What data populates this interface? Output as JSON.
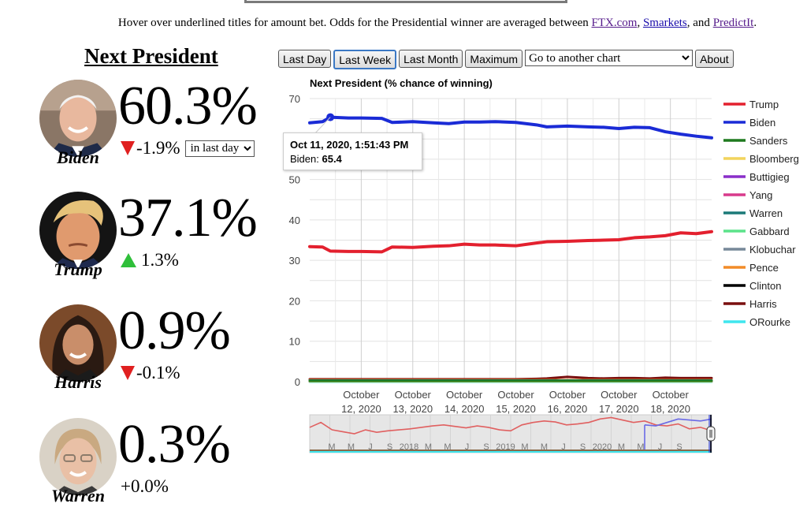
{
  "notice": {
    "text": "Hover over underlined titles for amount bet. Odds for the Presidential winner are averaged between ",
    "links": [
      "FTX.com",
      "Smarkets",
      "PredictIt"
    ],
    "sep1": ", ",
    "sep2": ", and ",
    "end": "."
  },
  "heading": "Next President",
  "candidates": [
    {
      "name": "Biden",
      "pct": "60.3%",
      "change": "-1.9%",
      "direction": "down"
    },
    {
      "name": "Trump",
      "pct": "37.1%",
      "change": "1.3%",
      "direction": "up"
    },
    {
      "name": "Harris",
      "pct": "0.9%",
      "change": "-0.1%",
      "direction": "down"
    },
    {
      "name": "Warren",
      "pct": "0.3%",
      "change": "+0.0%",
      "direction": "none"
    }
  ],
  "period_select": {
    "value": "in last day"
  },
  "toolbar": {
    "buttons": [
      "Last Day",
      "Last Week",
      "Last Month",
      "Maximum"
    ],
    "active": "Last Week",
    "chart_select": "Go to another chart",
    "about": "About"
  },
  "tooltip": {
    "title": "Oct 11, 2020, 1:51:43 PM",
    "label": "Biden: ",
    "value": "65.4"
  },
  "chart_data": {
    "type": "line",
    "title": "Next President (% chance of winning)",
    "xlabel": "",
    "ylabel": "",
    "ylim": [
      0,
      70
    ],
    "yticks": [
      0,
      10,
      20,
      30,
      40,
      50,
      60,
      70
    ],
    "ytick_labels": [
      "0",
      "10",
      "20",
      "",
      "30",
      "40",
      "50",
      "70"
    ],
    "grid": true,
    "legend": "right",
    "x_range_days": [
      0,
      7.8
    ],
    "xticks": [
      {
        "day": 1,
        "label": [
          "October",
          "12, 2020"
        ]
      },
      {
        "day": 2,
        "label": [
          "October",
          "13, 2020"
        ]
      },
      {
        "day": 3,
        "label": [
          "October",
          "14, 2020"
        ]
      },
      {
        "day": 4,
        "label": [
          "October",
          "15, 2020"
        ]
      },
      {
        "day": 5,
        "label": [
          "October",
          "16, 2020"
        ]
      },
      {
        "day": 6,
        "label": [
          "October",
          "17, 2020"
        ]
      },
      {
        "day": 7,
        "label": [
          "October",
          "18, 2020"
        ]
      }
    ],
    "x": [
      0,
      0.25,
      0.4,
      0.75,
      1.0,
      1.4,
      1.6,
      2.0,
      2.4,
      2.7,
      3.0,
      3.3,
      3.6,
      4.0,
      4.4,
      4.6,
      5.0,
      5.4,
      5.7,
      6.0,
      6.3,
      6.6,
      6.9,
      7.2,
      7.5,
      7.8
    ],
    "series": [
      {
        "name": "Trump",
        "color": "#e3202e",
        "values": [
          33.4,
          33.3,
          32.3,
          32.2,
          32.2,
          32.1,
          33.3,
          33.2,
          33.5,
          33.6,
          34.0,
          33.8,
          33.8,
          33.6,
          34.3,
          34.6,
          34.7,
          34.9,
          35.0,
          35.1,
          35.6,
          35.8,
          36.1,
          36.8,
          36.6,
          37.1
        ]
      },
      {
        "name": "Biden",
        "color": "#1a2bd6",
        "values": [
          64.0,
          64.3,
          65.4,
          65.2,
          65.2,
          65.1,
          64.1,
          64.3,
          64.0,
          63.8,
          64.2,
          64.2,
          64.3,
          64.1,
          63.5,
          63.0,
          63.2,
          63.0,
          62.9,
          62.6,
          62.9,
          62.8,
          61.8,
          61.2,
          60.7,
          60.3
        ]
      },
      {
        "name": "Sanders",
        "color": "#1f7a1f",
        "values": [
          0.2,
          0.2,
          0.2,
          0.2,
          0.2,
          0.2,
          0.2,
          0.2,
          0.2,
          0.2,
          0.2,
          0.2,
          0.2,
          0.2,
          0.2,
          0.2,
          0.2,
          0.2,
          0.2,
          0.2,
          0.2,
          0.2,
          0.2,
          0.2,
          0.2,
          0.2
        ]
      },
      {
        "name": "Bloomberg",
        "color": "#f2d45c",
        "values": [
          0.1,
          0.1,
          0.1,
          0.1,
          0.1,
          0.1,
          0.1,
          0.1,
          0.1,
          0.1,
          0.1,
          0.1,
          0.1,
          0.1,
          0.1,
          0.1,
          0.1,
          0.1,
          0.1,
          0.1,
          0.1,
          0.1,
          0.1,
          0.1,
          0.1,
          0.1
        ]
      },
      {
        "name": "Buttigieg",
        "color": "#8a2fc9",
        "values": [
          0.1,
          0.1,
          0.1,
          0.1,
          0.1,
          0.1,
          0.1,
          0.1,
          0.1,
          0.1,
          0.1,
          0.1,
          0.1,
          0.1,
          0.1,
          0.1,
          0.1,
          0.1,
          0.1,
          0.1,
          0.1,
          0.1,
          0.1,
          0.1,
          0.1,
          0.1
        ]
      },
      {
        "name": "Yang",
        "color": "#d83a8c",
        "values": [
          0.1,
          0.1,
          0.1,
          0.1,
          0.1,
          0.1,
          0.1,
          0.1,
          0.1,
          0.1,
          0.1,
          0.1,
          0.1,
          0.1,
          0.1,
          0.1,
          0.1,
          0.1,
          0.1,
          0.1,
          0.1,
          0.1,
          0.1,
          0.1,
          0.1,
          0.1
        ]
      },
      {
        "name": "Warren",
        "color": "#1b7a78",
        "values": [
          0.3,
          0.3,
          0.3,
          0.3,
          0.3,
          0.3,
          0.3,
          0.3,
          0.3,
          0.3,
          0.3,
          0.3,
          0.3,
          0.3,
          0.3,
          0.3,
          0.3,
          0.3,
          0.3,
          0.3,
          0.3,
          0.3,
          0.3,
          0.3,
          0.3,
          0.3
        ]
      },
      {
        "name": "Gabbard",
        "color": "#5be38a",
        "values": [
          0.1,
          0.1,
          0.1,
          0.1,
          0.1,
          0.1,
          0.1,
          0.1,
          0.1,
          0.1,
          0.1,
          0.1,
          0.1,
          0.1,
          0.1,
          0.1,
          0.1,
          0.1,
          0.1,
          0.1,
          0.1,
          0.1,
          0.1,
          0.1,
          0.1,
          0.1
        ]
      },
      {
        "name": "Klobuchar",
        "color": "#778899",
        "values": [
          0.1,
          0.1,
          0.1,
          0.1,
          0.1,
          0.1,
          0.1,
          0.1,
          0.1,
          0.1,
          0.1,
          0.1,
          0.1,
          0.1,
          0.1,
          0.1,
          0.1,
          0.1,
          0.1,
          0.1,
          0.1,
          0.1,
          0.1,
          0.1,
          0.1,
          0.1
        ]
      },
      {
        "name": "Pence",
        "color": "#f28c28",
        "values": [
          0.4,
          0.4,
          0.4,
          0.4,
          0.4,
          0.4,
          0.4,
          0.4,
          0.4,
          0.4,
          0.4,
          0.4,
          0.4,
          0.4,
          0.4,
          0.4,
          0.4,
          0.4,
          0.4,
          0.4,
          0.4,
          0.4,
          0.4,
          0.4,
          0.4,
          0.4
        ]
      },
      {
        "name": "Clinton",
        "color": "#000000",
        "values": [
          0.2,
          0.2,
          0.2,
          0.2,
          0.2,
          0.2,
          0.2,
          0.2,
          0.2,
          0.2,
          0.2,
          0.2,
          0.2,
          0.2,
          0.2,
          0.2,
          0.2,
          0.2,
          0.2,
          0.2,
          0.2,
          0.2,
          0.2,
          0.2,
          0.2,
          0.2
        ]
      },
      {
        "name": "Harris",
        "color": "#7a0f0f",
        "values": [
          0.6,
          0.6,
          0.6,
          0.6,
          0.6,
          0.6,
          0.6,
          0.6,
          0.6,
          0.6,
          0.6,
          0.6,
          0.6,
          0.6,
          0.7,
          0.8,
          1.2,
          0.9,
          0.8,
          0.9,
          0.9,
          0.8,
          1.0,
          0.9,
          0.9,
          0.9
        ]
      },
      {
        "name": "ORourke",
        "color": "#3fe6ee",
        "values": [
          0.0,
          0.0,
          0.0,
          0.0,
          0.0,
          0.0,
          0.0,
          0.0,
          0.0,
          0.0,
          0.0,
          0.0,
          0.0,
          0.0,
          0.0,
          0.0,
          0.0,
          0.0,
          0.0,
          0.0,
          0.0,
          0.0,
          0.0,
          0.0,
          0.0,
          0.0
        ]
      }
    ],
    "navigator": {
      "labels": [
        "M",
        "M",
        "J",
        "S",
        "2018",
        "M",
        "M",
        "J",
        "S",
        "2019",
        "M",
        "M",
        "J",
        "S",
        "2020",
        "M",
        "M",
        "J",
        "S"
      ],
      "trump": [
        45,
        55,
        40,
        36,
        32,
        40,
        35,
        38,
        40,
        42,
        45,
        48,
        50,
        47,
        44,
        48,
        45,
        40,
        38,
        50,
        55,
        58,
        56,
        50,
        52,
        55,
        62,
        65,
        60,
        55,
        58,
        50,
        48,
        52,
        42,
        45,
        38
      ],
      "biden": [
        0,
        0,
        0,
        0,
        0,
        0,
        0,
        0,
        0,
        0,
        0,
        0,
        0,
        0,
        0,
        0,
        0,
        0,
        0,
        0,
        0,
        0,
        0,
        0,
        0,
        0,
        0,
        0,
        0,
        0,
        50,
        48,
        55,
        62,
        60,
        58,
        62
      ]
    }
  }
}
